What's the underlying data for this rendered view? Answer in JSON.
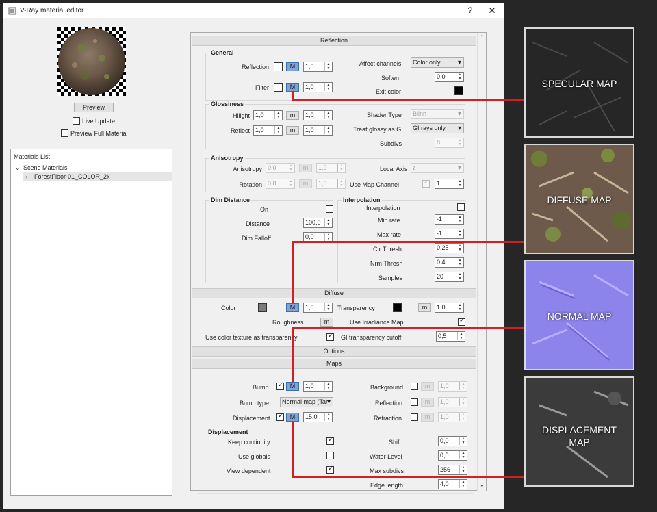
{
  "window": {
    "title": "V-Ray material editor",
    "help": "?",
    "close": "✕"
  },
  "left": {
    "preview_button": "Preview",
    "live_update": "Live Update",
    "preview_full": "Preview Full Material",
    "materials_list_title": "Materials List",
    "scene_materials": "Scene Materials",
    "material_item": "ForestFloor-01_COLOR_2k"
  },
  "sections": {
    "reflection": "Reflection",
    "diffuse": "Diffuse",
    "options": "Options",
    "maps": "Maps"
  },
  "general": {
    "title": "General",
    "reflection_label": "Reflection",
    "reflection_value": "1,0",
    "m": "M",
    "filter_label": "Filter",
    "filter_value": "1,0",
    "affect_channels_label": "Affect channels",
    "affect_channels_value": "Color only",
    "soften_label": "Soften",
    "soften_value": "0,0",
    "exit_color_label": "Exit color"
  },
  "glossiness": {
    "title": "Glossiness",
    "hilight_label": "Hilight",
    "hilight_value": "1,0",
    "hilight_value2": "1,0",
    "reflect_label": "Reflect",
    "reflect_value": "1,0",
    "reflect_value2": "1,0",
    "m": "m",
    "shader_type_label": "Shader Type",
    "shader_type_value": "Blinn",
    "treat_glossy_label": "Treat glossy as GI",
    "treat_glossy_value": "GI rays only",
    "subdivs_label": "Subdivs",
    "subdivs_value": "8"
  },
  "anisotropy": {
    "title": "Anisotropy",
    "anisotropy_label": "Anisotropy",
    "anisotropy_value": "0,0",
    "anisotropy_value2": "1,0",
    "rotation_label": "Rotation",
    "rotation_value": "0,0",
    "rotation_value2": "1,0",
    "local_axis_label": "Local Axis",
    "local_axis_value": "z",
    "use_map_channel_label": "Use Map Channel",
    "map_channel_value": "1"
  },
  "dim_distance": {
    "title": "Dim Distance",
    "on_label": "On",
    "distance_label": "Distance",
    "distance_value": "100,0",
    "dim_falloff_label": "Dim Falloff",
    "dim_falloff_value": "0,0"
  },
  "interpolation": {
    "title": "Interpolation",
    "interpolation_label": "Interpolation",
    "min_rate_label": "Min rate",
    "min_rate_value": "-1",
    "max_rate_label": "Max rate",
    "max_rate_value": "-1",
    "clr_thresh_label": "Clr Thresh",
    "clr_thresh_value": "0,25",
    "nrm_thresh_label": "Nrm Thresh",
    "nrm_thresh_value": "0,4",
    "samples_label": "Samples",
    "samples_value": "20"
  },
  "diffuse": {
    "color_label": "Color",
    "color_value": "1,0",
    "transparency_label": "Transparency",
    "transparency_value": "1,0",
    "roughness_label": "Roughness",
    "use_irradiance_label": "Use Irradiance Map",
    "use_color_texture_label": "Use color texture as transparency",
    "gi_cutoff_label": "GI transparency cutoff",
    "gi_cutoff_value": "0,5"
  },
  "maps": {
    "bump_label": "Bump",
    "bump_value": "1,0",
    "bump_type_label": "Bump type",
    "bump_type_value": "Normal map (Tar",
    "displacement_label": "Displacement",
    "displacement_value": "15,0",
    "background_label": "Background",
    "background_value": "1,0",
    "reflection_label": "Reflection",
    "reflection_value": "1,0",
    "refraction_label": "Refraction",
    "refraction_value": "1,0"
  },
  "displacement": {
    "title": "Displacement",
    "keep_continuity_label": "Keep continuity",
    "use_globals_label": "Use globals",
    "view_dependent_label": "View dependent",
    "shift_label": "Shift",
    "shift_value": "0,0",
    "water_level_label": "Water Level",
    "water_level_value": "0,0",
    "max_subdivs_label": "Max subdivs",
    "max_subdivs_value": "256",
    "edge_length_label": "Edge length",
    "edge_length_value": "4,0"
  },
  "thumbs": {
    "specular": "SPECULAR MAP",
    "diffuse": "DIFFUSE MAP",
    "normal": "NORMAL MAP",
    "displacement_line1": "DISPLACEMENT",
    "displacement_line2": "MAP"
  },
  "colors": {
    "accent_line": "#d21f1f",
    "m_button_on": "#7ea3d6"
  }
}
